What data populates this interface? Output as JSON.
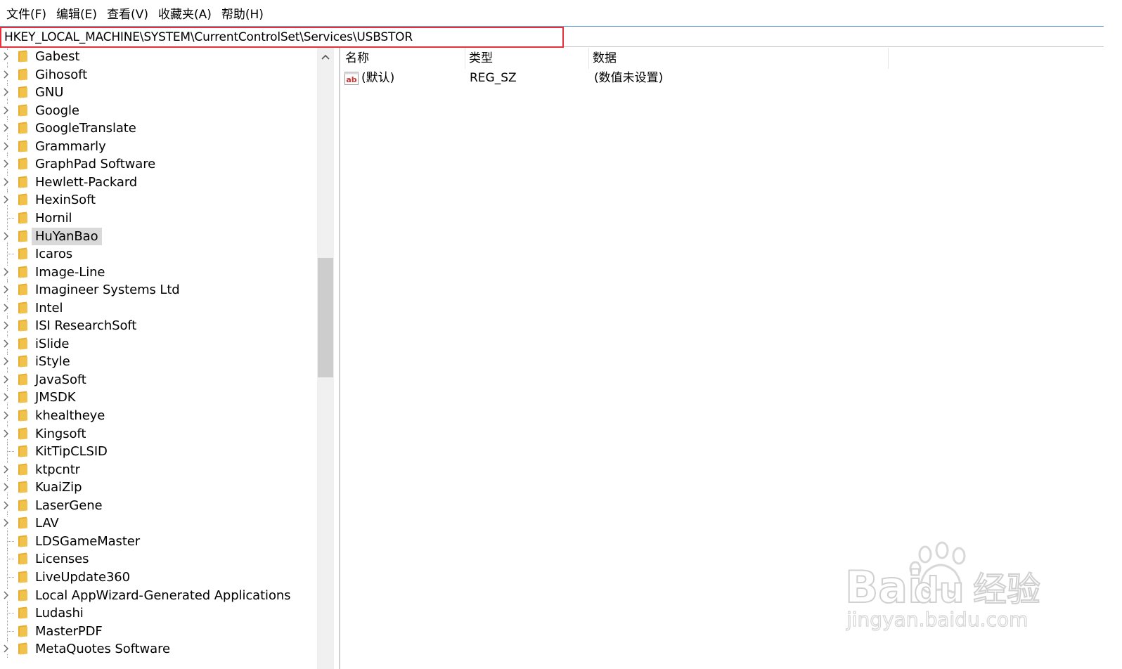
{
  "menu": [
    "文件(F)",
    "编辑(E)",
    "查看(V)",
    "收藏夹(A)",
    "帮助(H)"
  ],
  "address": {
    "path": "HKEY_LOCAL_MACHINE\\SYSTEM\\CurrentControlSet\\Services\\USBSTOR"
  },
  "tree": {
    "items": [
      {
        "label": "Gabest",
        "expandable": true
      },
      {
        "label": "Gihosoft",
        "expandable": true
      },
      {
        "label": "GNU",
        "expandable": true
      },
      {
        "label": "Google",
        "expandable": true
      },
      {
        "label": "GoogleTranslate",
        "expandable": true
      },
      {
        "label": "Grammarly",
        "expandable": true
      },
      {
        "label": "GraphPad Software",
        "expandable": true
      },
      {
        "label": "Hewlett-Packard",
        "expandable": true
      },
      {
        "label": "HexinSoft",
        "expandable": true
      },
      {
        "label": "Hornil",
        "expandable": false
      },
      {
        "label": "HuYanBao",
        "expandable": true,
        "selected": true
      },
      {
        "label": "Icaros",
        "expandable": false
      },
      {
        "label": "Image-Line",
        "expandable": true
      },
      {
        "label": "Imagineer Systems Ltd",
        "expandable": true
      },
      {
        "label": "Intel",
        "expandable": true
      },
      {
        "label": "ISI ResearchSoft",
        "expandable": true
      },
      {
        "label": "iSlide",
        "expandable": true
      },
      {
        "label": "iStyle",
        "expandable": true
      },
      {
        "label": "JavaSoft",
        "expandable": true
      },
      {
        "label": "JMSDK",
        "expandable": true
      },
      {
        "label": "khealtheye",
        "expandable": true
      },
      {
        "label": "Kingsoft",
        "expandable": true
      },
      {
        "label": "KitTipCLSID",
        "expandable": false
      },
      {
        "label": "ktpcntr",
        "expandable": true
      },
      {
        "label": "KuaiZip",
        "expandable": true
      },
      {
        "label": "LaserGene",
        "expandable": true
      },
      {
        "label": "LAV",
        "expandable": true
      },
      {
        "label": "LDSGameMaster",
        "expandable": false
      },
      {
        "label": "Licenses",
        "expandable": false
      },
      {
        "label": "LiveUpdate360",
        "expandable": false
      },
      {
        "label": "Local AppWizard-Generated Applications",
        "expandable": true
      },
      {
        "label": "Ludashi",
        "expandable": false
      },
      {
        "label": "MasterPDF",
        "expandable": false
      },
      {
        "label": "MetaQuotes Software",
        "expandable": true
      }
    ]
  },
  "values": {
    "columns": [
      "名称",
      "类型",
      "数据"
    ],
    "rows": [
      {
        "name": "(默认)",
        "type": "REG_SZ",
        "data": "(数值未设置)"
      }
    ]
  },
  "watermark": {
    "brand": "Bai",
    "brand2": "du",
    "product": "经验",
    "url": "jingyan.baidu.com"
  },
  "colors": {
    "highlight_border": "#e8303b",
    "folder": "#f0c24b",
    "selection": "#d9d9d9"
  }
}
